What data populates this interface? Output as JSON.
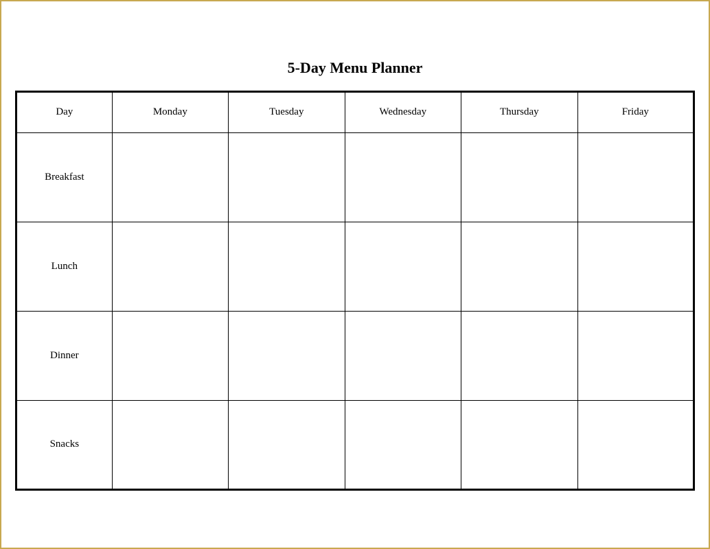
{
  "title": "5-Day Menu Planner",
  "table": {
    "headers": [
      "Day",
      "Monday",
      "Tuesday",
      "Wednesday",
      "Thursday",
      "Friday"
    ],
    "rows": [
      {
        "label": "Breakfast",
        "cells": [
          "",
          "",
          "",
          "",
          ""
        ]
      },
      {
        "label": "Lunch",
        "cells": [
          "",
          "",
          "",
          "",
          ""
        ]
      },
      {
        "label": "Dinner",
        "cells": [
          "",
          "",
          "",
          "",
          ""
        ]
      },
      {
        "label": "Snacks",
        "cells": [
          "",
          "",
          "",
          "",
          ""
        ]
      }
    ]
  }
}
